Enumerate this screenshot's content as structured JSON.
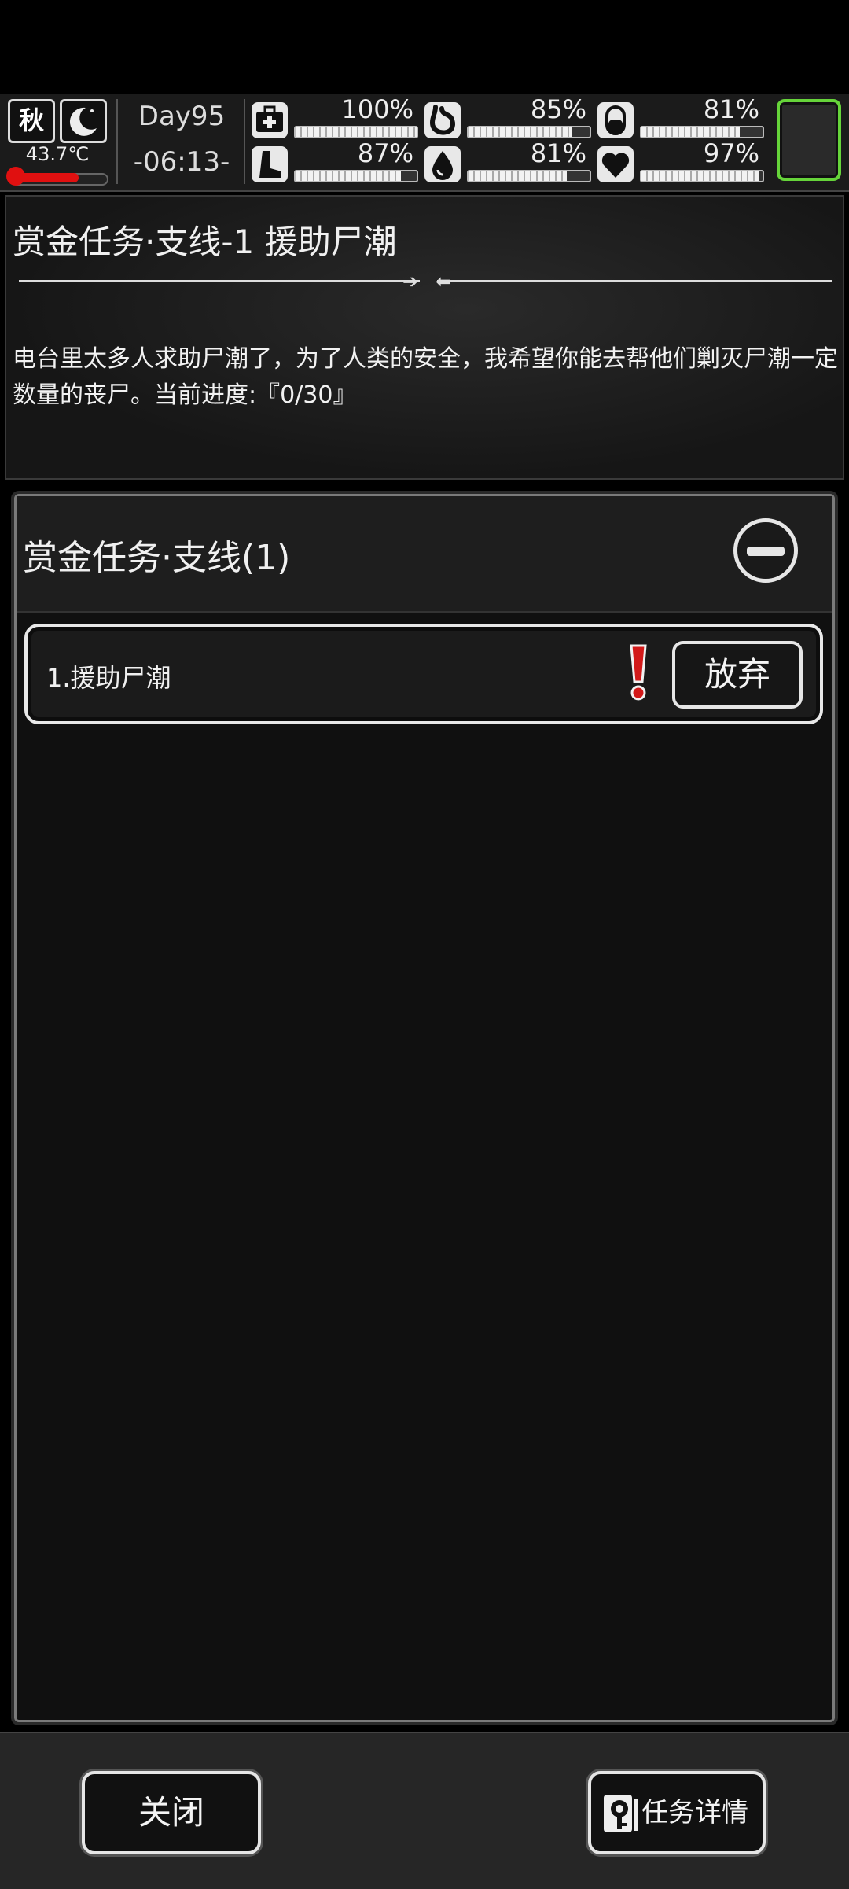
{
  "status": {
    "season": "秋",
    "temperature": "43.7℃",
    "temperature_level": 0.72,
    "day": "Day95",
    "time": "-06:13-",
    "stats": [
      {
        "icon": "medkit-icon",
        "pct": "100%",
        "level": 1.0
      },
      {
        "icon": "stomach-icon",
        "pct": "85%",
        "level": 0.85
      },
      {
        "icon": "pill-icon",
        "pct": "81%",
        "level": 0.81
      },
      {
        "icon": "boot-icon",
        "pct": "87%",
        "level": 0.87
      },
      {
        "icon": "water-drop-icon",
        "pct": "81%",
        "level": 0.81
      },
      {
        "icon": "heart-icon",
        "pct": "97%",
        "level": 0.97
      }
    ]
  },
  "quest": {
    "title": "赏金任务·支线-1 援助尸潮",
    "description": "电台里太多人求助尸潮了，为了人类的安全，我希望你能去帮他们剿灭尸潮一定数量的丧尸。当前进度:『0/30』"
  },
  "panel": {
    "title": "赏金任务·支线(1)",
    "items": [
      {
        "label": "1.援助尸潮",
        "action": "放弃"
      }
    ]
  },
  "footer": {
    "close_label": "关闭",
    "details_label": "任务详情"
  },
  "colors": {
    "accent_green": "#66d43a",
    "alert_red": "#d31a1a"
  }
}
